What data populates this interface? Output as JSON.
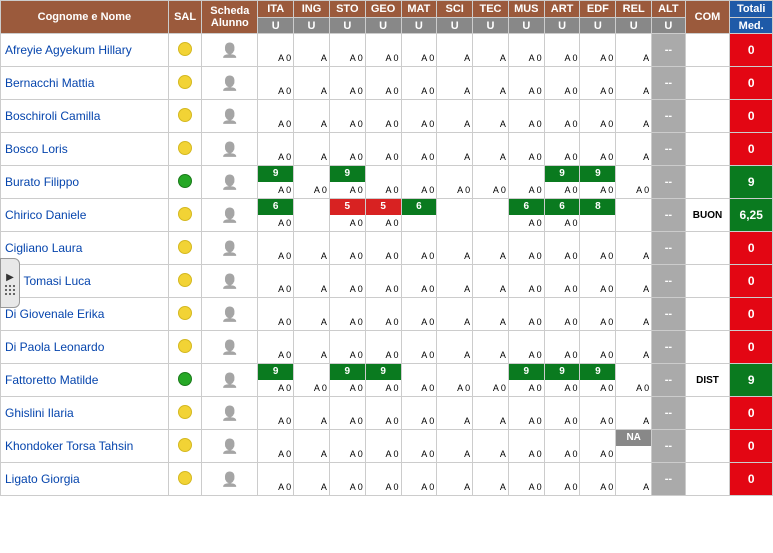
{
  "headers": {
    "name": "Cognome e Nome",
    "sal": "SAL",
    "scheda": "Scheda Alunno",
    "subjects": [
      "ITA",
      "ING",
      "STO",
      "GEO",
      "MAT",
      "SCI",
      "TEC",
      "MUS",
      "ART",
      "EDF",
      "REL",
      "ALT"
    ],
    "com": "COM",
    "totali": "Totali",
    "med": "Med.",
    "u": "U"
  },
  "students": [
    {
      "name": "Afreyie Agyekum Hillary",
      "sal": "yellow",
      "alt": "--",
      "com": "",
      "tot": "0",
      "totClass": "tot-red",
      "cells": [
        {
          "b": "A 0"
        },
        {
          "b": "A"
        },
        {
          "b": "A 0"
        },
        {
          "b": "A 0"
        },
        {
          "b": "A 0"
        },
        {
          "b": "A"
        },
        {
          "b": "A"
        },
        {
          "b": "A 0"
        },
        {
          "b": "A 0"
        },
        {
          "b": "A 0"
        },
        {
          "b": "A"
        }
      ]
    },
    {
      "name": "Bernacchi Mattia",
      "sal": "yellow",
      "alt": "--",
      "com": "",
      "tot": "0",
      "totClass": "tot-red",
      "cells": [
        {
          "b": "A 0"
        },
        {
          "b": "A"
        },
        {
          "b": "A 0"
        },
        {
          "b": "A 0"
        },
        {
          "b": "A 0"
        },
        {
          "b": "A"
        },
        {
          "b": "A"
        },
        {
          "b": "A 0"
        },
        {
          "b": "A 0"
        },
        {
          "b": "A 0"
        },
        {
          "b": "A"
        }
      ]
    },
    {
      "name": "Boschiroli Camilla",
      "sal": "yellow",
      "alt": "--",
      "com": "",
      "tot": "0",
      "totClass": "tot-red",
      "cells": [
        {
          "b": "A 0"
        },
        {
          "b": "A"
        },
        {
          "b": "A 0"
        },
        {
          "b": "A 0"
        },
        {
          "b": "A 0"
        },
        {
          "b": "A"
        },
        {
          "b": "A"
        },
        {
          "b": "A 0"
        },
        {
          "b": "A 0"
        },
        {
          "b": "A 0"
        },
        {
          "b": "A"
        }
      ]
    },
    {
      "name": "Bosco Loris",
      "sal": "yellow",
      "alt": "--",
      "com": "",
      "tot": "0",
      "totClass": "tot-red",
      "cells": [
        {
          "b": "A 0"
        },
        {
          "b": "A"
        },
        {
          "b": "A 0"
        },
        {
          "b": "A 0"
        },
        {
          "b": "A 0"
        },
        {
          "b": "A"
        },
        {
          "b": "A"
        },
        {
          "b": "A 0"
        },
        {
          "b": "A 0"
        },
        {
          "b": "A 0"
        },
        {
          "b": "A"
        }
      ]
    },
    {
      "name": "Burato Filippo",
      "sal": "green",
      "alt": "--",
      "com": "",
      "tot": "9",
      "totClass": "tot-green",
      "cells": [
        {
          "t": "9",
          "tc": "bg-green",
          "b": "A 0"
        },
        {
          "b": "A 0"
        },
        {
          "t": "9",
          "tc": "bg-green",
          "b": "A 0"
        },
        {
          "b": "A 0"
        },
        {
          "b": "A 0"
        },
        {
          "b": "A 0"
        },
        {
          "b": "A 0"
        },
        {
          "b": "A 0"
        },
        {
          "t": "9",
          "tc": "bg-green",
          "b": "A 0"
        },
        {
          "t": "9",
          "tc": "bg-green",
          "b": "A 0"
        },
        {
          "b": "A 0"
        }
      ]
    },
    {
      "name": "Chirico Daniele",
      "sal": "yellow",
      "alt": "--",
      "com": "BUON",
      "tot": "6,25",
      "totClass": "tot-green",
      "cells": [
        {
          "t": "6",
          "tc": "bg-green",
          "b": "A 0"
        },
        {
          "b": ""
        },
        {
          "t": "5",
          "tc": "bg-red",
          "b": "A 0"
        },
        {
          "t": "5",
          "tc": "bg-red",
          "b": "A 0"
        },
        {
          "t": "6",
          "tc": "bg-green",
          "b": ""
        },
        {
          "b": ""
        },
        {
          "b": ""
        },
        {
          "t": "6",
          "tc": "bg-green",
          "b": "A 0"
        },
        {
          "t": "6",
          "tc": "bg-green",
          "b": "A 0"
        },
        {
          "t": "8",
          "tc": "bg-green",
          "b": ""
        },
        {
          "b": ""
        }
      ]
    },
    {
      "name": "Cigliano Laura",
      "sal": "yellow",
      "alt": "--",
      "com": "",
      "tot": "0",
      "totClass": "tot-red",
      "cells": [
        {
          "b": "A 0"
        },
        {
          "b": "A"
        },
        {
          "b": "A 0"
        },
        {
          "b": "A 0"
        },
        {
          "b": "A 0"
        },
        {
          "b": "A"
        },
        {
          "b": "A"
        },
        {
          "b": "A 0"
        },
        {
          "b": "A 0"
        },
        {
          "b": "A 0"
        },
        {
          "b": "A"
        }
      ]
    },
    {
      "name": "De Tomasi Luca",
      "sal": "yellow",
      "alt": "--",
      "com": "",
      "tot": "0",
      "totClass": "tot-red",
      "cells": [
        {
          "b": "A 0"
        },
        {
          "b": "A"
        },
        {
          "b": "A 0"
        },
        {
          "b": "A 0"
        },
        {
          "b": "A 0"
        },
        {
          "b": "A"
        },
        {
          "b": "A"
        },
        {
          "b": "A 0"
        },
        {
          "b": "A 0"
        },
        {
          "b": "A 0"
        },
        {
          "b": "A"
        }
      ]
    },
    {
      "name": "Di Giovenale Erika",
      "sal": "yellow",
      "alt": "--",
      "com": "",
      "tot": "0",
      "totClass": "tot-red",
      "cells": [
        {
          "b": "A 0"
        },
        {
          "b": "A"
        },
        {
          "b": "A 0"
        },
        {
          "b": "A 0"
        },
        {
          "b": "A 0"
        },
        {
          "b": "A"
        },
        {
          "b": "A"
        },
        {
          "b": "A 0"
        },
        {
          "b": "A 0"
        },
        {
          "b": "A 0"
        },
        {
          "b": "A"
        }
      ]
    },
    {
      "name": "Di Paola Leonardo",
      "sal": "yellow",
      "alt": "--",
      "com": "",
      "tot": "0",
      "totClass": "tot-red",
      "cells": [
        {
          "b": "A 0"
        },
        {
          "b": "A"
        },
        {
          "b": "A 0"
        },
        {
          "b": "A 0"
        },
        {
          "b": "A 0"
        },
        {
          "b": "A"
        },
        {
          "b": "A"
        },
        {
          "b": "A 0"
        },
        {
          "b": "A 0"
        },
        {
          "b": "A 0"
        },
        {
          "b": "A"
        }
      ]
    },
    {
      "name": "Fattoretto Matilde",
      "sal": "green",
      "alt": "--",
      "com": "DIST",
      "tot": "9",
      "totClass": "tot-green",
      "cells": [
        {
          "t": "9",
          "tc": "bg-green",
          "b": "A 0"
        },
        {
          "b": "A 0"
        },
        {
          "t": "9",
          "tc": "bg-green",
          "b": "A 0"
        },
        {
          "t": "9",
          "tc": "bg-green",
          "b": "A 0"
        },
        {
          "b": "A 0"
        },
        {
          "b": "A 0"
        },
        {
          "b": "A 0"
        },
        {
          "t": "9",
          "tc": "bg-green",
          "b": "A 0"
        },
        {
          "t": "9",
          "tc": "bg-green",
          "b": "A 0"
        },
        {
          "t": "9",
          "tc": "bg-green",
          "b": "A 0"
        },
        {
          "b": "A 0"
        }
      ]
    },
    {
      "name": "Ghislini Ilaria",
      "sal": "yellow",
      "alt": "--",
      "com": "",
      "tot": "0",
      "totClass": "tot-red",
      "cells": [
        {
          "b": "A 0"
        },
        {
          "b": "A"
        },
        {
          "b": "A 0"
        },
        {
          "b": "A 0"
        },
        {
          "b": "A 0"
        },
        {
          "b": "A"
        },
        {
          "b": "A"
        },
        {
          "b": "A 0"
        },
        {
          "b": "A 0"
        },
        {
          "b": "A 0"
        },
        {
          "b": "A"
        }
      ]
    },
    {
      "name": "Khondoker Torsa Tahsin",
      "sal": "yellow",
      "alt": "--",
      "com": "",
      "tot": "0",
      "totClass": "tot-red",
      "relNA": true,
      "cells": [
        {
          "b": "A 0"
        },
        {
          "b": "A"
        },
        {
          "b": "A 0"
        },
        {
          "b": "A 0"
        },
        {
          "b": "A 0"
        },
        {
          "b": "A"
        },
        {
          "b": "A"
        },
        {
          "b": "A 0"
        },
        {
          "b": "A 0"
        },
        {
          "b": "A 0"
        },
        {
          "b": ""
        }
      ]
    },
    {
      "name": "Ligato Giorgia",
      "sal": "yellow",
      "alt": "--",
      "com": "",
      "tot": "0",
      "totClass": "tot-red",
      "cells": [
        {
          "b": "A 0"
        },
        {
          "b": "A"
        },
        {
          "b": "A 0"
        },
        {
          "b": "A 0"
        },
        {
          "b": "A 0"
        },
        {
          "b": "A"
        },
        {
          "b": "A"
        },
        {
          "b": "A 0"
        },
        {
          "b": "A 0"
        },
        {
          "b": "A 0"
        },
        {
          "b": "A"
        }
      ]
    }
  ],
  "naLabel": "NA"
}
